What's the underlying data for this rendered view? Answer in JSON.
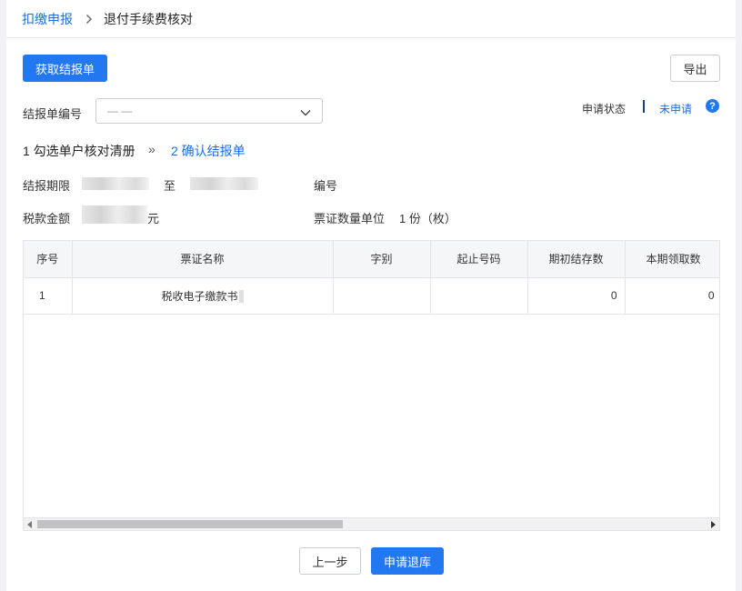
{
  "breadcrumb": {
    "parent": "扣缴申报",
    "current": "退付手续费核对"
  },
  "toolbar": {
    "fetch_label": "获取结报单",
    "export_label": "导出"
  },
  "form": {
    "report_no_label": "结报单编号",
    "report_no_placeholder": "— —"
  },
  "status": {
    "label": "申请状态",
    "value": "未申请",
    "help_glyph": "?"
  },
  "steps": {
    "step1": "1 勾选单户核对清册",
    "arrow": "»",
    "step2": "2 确认结报单"
  },
  "info": {
    "period_label": "结报期限",
    "to_label": "至",
    "number_label": "编号",
    "amount_label": "税款金额",
    "amount_suffix": "元",
    "unit_label": "票证数量单位",
    "unit_value": "1 份（枚）"
  },
  "table": {
    "headers": [
      "序号",
      "票证名称",
      "字别",
      "起止号码",
      "期初结存数",
      "本期领取数"
    ],
    "rows": [
      {
        "index": "1",
        "name": "税收电子缴款书",
        "type": "",
        "range": "",
        "opening": "0",
        "received": "0"
      }
    ]
  },
  "footer": {
    "prev_label": "上一步",
    "apply_label": "申请退库"
  },
  "colors": {
    "primary": "#2178f0",
    "link": "#1a6fdc"
  }
}
